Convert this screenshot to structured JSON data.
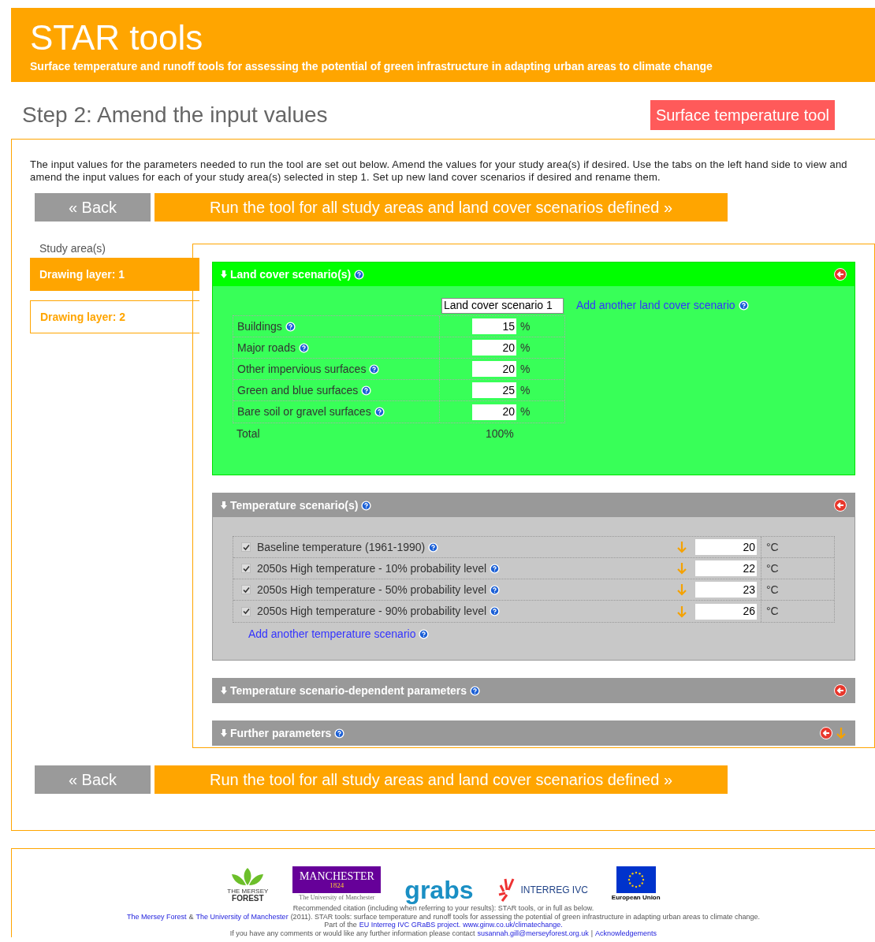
{
  "header": {
    "title": "STAR tools",
    "subtitle": "Surface temperature and runoff tools for assessing the potential of green infrastructure in adapting urban areas to climate change"
  },
  "step": {
    "title": "Step 2: Amend the input values",
    "tool_badge": "Surface temperature tool"
  },
  "intro": "The input values for the parameters needed to run the tool are set out below. Amend the values for your study area(s) if desired. Use the tabs on the left hand side to view and amend the input values for each of your study area(s) selected in step 1. Set up new land cover scenarios if desired and rename them.",
  "nav_top": {
    "back": "« Back",
    "run": "Run the tool for all study areas and land cover scenarios defined »"
  },
  "sidebar": {
    "heading": "Study area(s)",
    "tabs": [
      {
        "label": "Drawing layer: 1",
        "selected": true
      },
      {
        "label": "Drawing layer: 2",
        "selected": false
      }
    ]
  },
  "sections": [
    {
      "kind": "land_cover",
      "title": "Land cover scenario(s)",
      "expanded": true,
      "arrow": false,
      "scenario_name": "Land cover scenario 1",
      "add_link": "Add another land cover scenario",
      "rows": [
        {
          "label": "Buildings",
          "value": "15",
          "unit": "%"
        },
        {
          "label": "Major roads",
          "value": "20",
          "unit": "%"
        },
        {
          "label": "Other impervious surfaces",
          "value": "20",
          "unit": "%"
        },
        {
          "label": "Green and blue surfaces",
          "value": "25",
          "unit": "%"
        },
        {
          "label": "Bare soil or gravel surfaces",
          "value": "20",
          "unit": "%"
        }
      ],
      "total_label": "Total",
      "total_value": "100%"
    },
    {
      "kind": "temperature",
      "title": "Temperature scenario(s)",
      "expanded": true,
      "arrow": false,
      "add_link": "Add another temperature scenario",
      "rows": [
        {
          "label": "Baseline temperature (1961-1990)",
          "checked": true,
          "value": "20",
          "unit": "°C"
        },
        {
          "label": "2050s High temperature - 10% probability level",
          "checked": true,
          "value": "22",
          "unit": "°C"
        },
        {
          "label": "2050s High temperature - 50% probability level",
          "checked": true,
          "value": "23",
          "unit": "°C"
        },
        {
          "label": "2050s High temperature - 90% probability level",
          "checked": true,
          "value": "26",
          "unit": "°C"
        }
      ]
    },
    {
      "kind": "plain",
      "title": "Temperature scenario-dependent parameters",
      "expanded": false,
      "arrow": false
    },
    {
      "kind": "plain",
      "title": "Further parameters",
      "expanded": false,
      "arrow": true
    }
  ],
  "nav_bottom": {
    "back": "« Back",
    "run": "Run the tool for all study areas and land cover scenarios defined »"
  },
  "footer": {
    "logos": [
      {
        "kind": "mersey",
        "lines": [
          "THE MERSEY",
          "FOREST"
        ]
      },
      {
        "kind": "manchester",
        "lines": [
          "MANCHESTER",
          "1824",
          "The University of Manchester"
        ]
      },
      {
        "kind": "grabs",
        "lines": [
          "grabs"
        ]
      },
      {
        "kind": "interreg",
        "lines": [
          "INTERREG IVC"
        ]
      },
      {
        "kind": "eu",
        "lines": [
          "European Union"
        ]
      }
    ],
    "lines": [
      [
        {
          "text": "Recommended citation (including when referring to your results): STAR tools, or in full as below.",
          "link": false
        }
      ],
      [
        {
          "text": "The Mersey Forest",
          "link": true
        },
        {
          "text": "&",
          "link": false
        },
        {
          "text": "The University of Manchester",
          "link": true
        },
        {
          "text": "(2011). STAR tools: surface temperature and runoff tools for assessing the potential of green infrastructure in adapting urban areas to climate change.",
          "link": false
        }
      ],
      [
        {
          "text": "Part of the",
          "link": false
        },
        {
          "text": "EU Interreg IVC GRaBS project.",
          "link": true
        },
        {
          "text": "www.ginw.co.uk/climatechange.",
          "link": true
        }
      ],
      [
        {
          "text": "If you have any comments or would like any further information please contact",
          "link": false
        },
        {
          "text": "susannah.gill@merseyforest.org.uk",
          "link": true
        },
        {
          "text": "|",
          "link": false
        },
        {
          "text": "Acknowledgements",
          "link": true
        }
      ]
    ]
  }
}
